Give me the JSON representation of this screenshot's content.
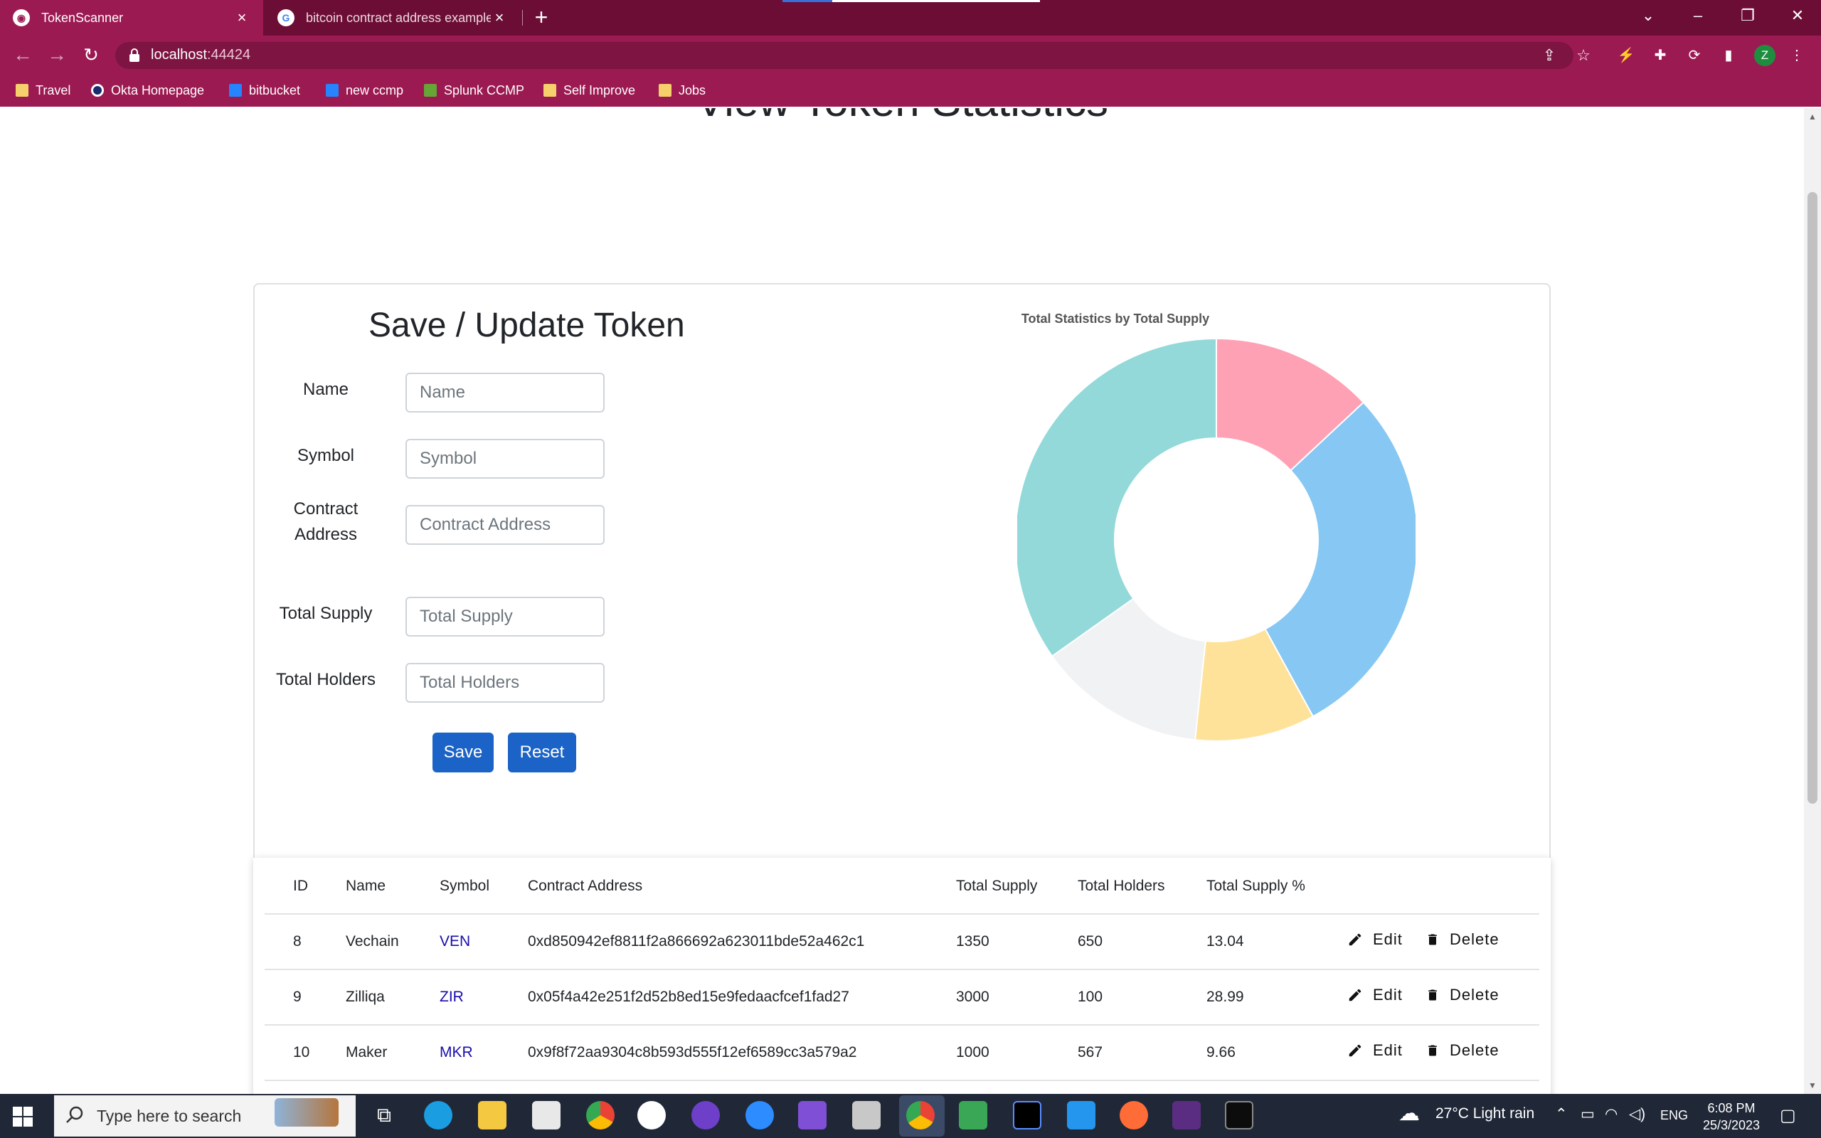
{
  "browser": {
    "tabs": [
      {
        "title": "TokenScanner",
        "active": true
      },
      {
        "title": "bitcoin contract address example",
        "active": false
      }
    ],
    "url_host": "localhost",
    "url_port": ":44424",
    "bookmarks": [
      "Travel",
      "Okta Homepage",
      "bitbucket",
      "new ccmp",
      "Splunk CCMP",
      "Self Improve",
      "Jobs"
    ],
    "profile_initial": "Z",
    "theme_color": "#9c1a52"
  },
  "page": {
    "heading": "View Token Statistics"
  },
  "form": {
    "title": "Save / Update Token",
    "fields": [
      {
        "label": "Name",
        "placeholder": "Name"
      },
      {
        "label": "Symbol",
        "placeholder": "Symbol"
      },
      {
        "label_line1": "Contract",
        "label_line2": "Address",
        "placeholder": "Contract Address"
      },
      {
        "label": "Total Supply",
        "placeholder": "Total Supply"
      },
      {
        "label": "Total Holders",
        "placeholder": "Total Holders"
      }
    ],
    "save_label": "Save",
    "reset_label": "Reset",
    "button_color": "#1b63c6"
  },
  "chart_data": {
    "type": "pie",
    "title": "Total Statistics by Total Supply",
    "donut": true,
    "legend": "none",
    "slices": [
      {
        "value": 13.04,
        "color": "#ffa1b5"
      },
      {
        "value": 28.99,
        "color": "#86c7f3"
      },
      {
        "value": 9.66,
        "color": "#ffe29a"
      },
      {
        "value": 13.5,
        "color": "#f1f2f4"
      },
      {
        "value": 34.81,
        "color": "#93d9d9"
      }
    ]
  },
  "table": {
    "headers": [
      "ID",
      "Name",
      "Symbol",
      "Contract Address",
      "Total Supply",
      "Total Holders",
      "Total Supply %"
    ],
    "edit_label": "Edit",
    "delete_label": "Delete",
    "rows": [
      {
        "id": "8",
        "name": "Vechain",
        "symbol": "VEN",
        "address": "0xd850942ef8811f2a866692a623011bde52a462c1",
        "supply": "1350",
        "holders": "650",
        "pct": "13.04"
      },
      {
        "id": "9",
        "name": "Zilliqa",
        "symbol": "ZIR",
        "address": "0x05f4a42e251f2d52b8ed15e9fedaacfcef1fad27",
        "supply": "3000",
        "holders": "100",
        "pct": "28.99"
      },
      {
        "id": "10",
        "name": "Maker",
        "symbol": "MKR",
        "address": "0x9f8f72aa9304c8b593d555f12ef6589cc3a579a2",
        "supply": "1000",
        "holders": "567",
        "pct": "9.66"
      }
    ]
  },
  "taskbar": {
    "search_placeholder": "Type here to search",
    "weather": "27°C  Light rain",
    "language": "ENG",
    "time": "6:08 PM",
    "date": "25/3/2023"
  }
}
